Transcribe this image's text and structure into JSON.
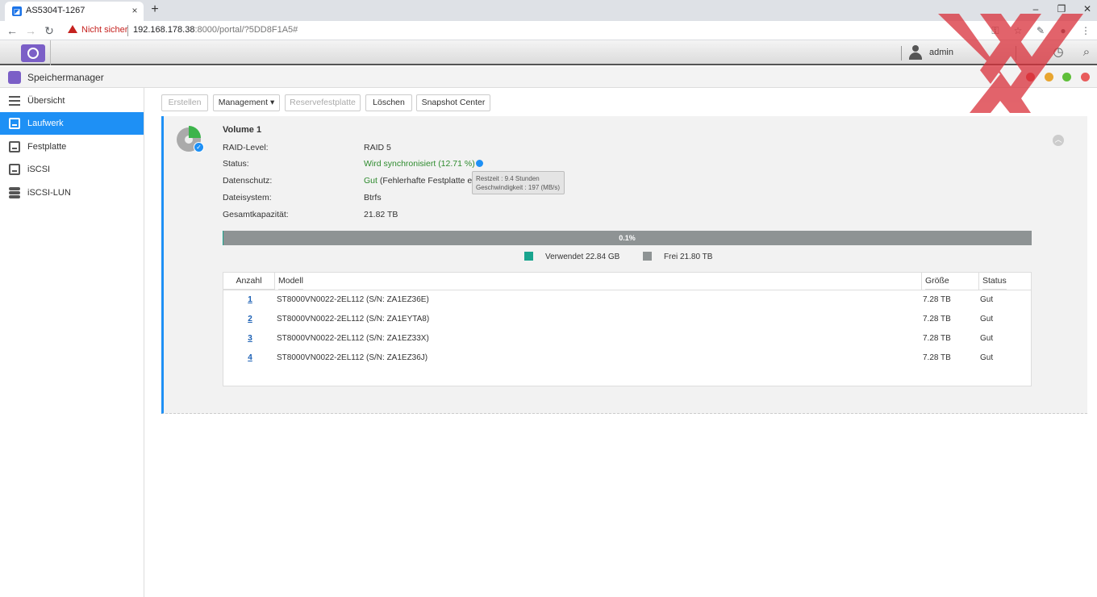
{
  "browser": {
    "tab_title": "AS5304T-1267",
    "tab_close": "×",
    "new_tab": "+",
    "window_controls": {
      "minimize": "–",
      "restore": "❐",
      "close": "✕"
    },
    "nav": {
      "back": "←",
      "forward": "→",
      "reload": "↻"
    },
    "security_label": "Nicht sicher",
    "url_host": "192.168.178.38",
    "url_rest": ":8000/portal/?5DD8F1A5#",
    "icons": {
      "key": "⚿",
      "star": "☆",
      "ext": "✎",
      "menu": "⋮"
    }
  },
  "adm": {
    "username": "admin",
    "icons": {
      "notify": "◷",
      "search": "⌕"
    }
  },
  "app": {
    "title": "Speichermanager",
    "window_dots": [
      "#e04a4a",
      "#e8a530",
      "#5fbf3a",
      "#e85b5b"
    ]
  },
  "sidebar": {
    "items": [
      {
        "label": "Übersicht",
        "active": false
      },
      {
        "label": "Laufwerk",
        "active": true
      },
      {
        "label": "Festplatte",
        "active": false
      },
      {
        "label": "iSCSI",
        "active": false
      },
      {
        "label": "iSCSI-LUN",
        "active": false
      }
    ]
  },
  "toolbar": {
    "create": "Erstellen",
    "management": "Management ▾",
    "spare": "Reservefestplatte",
    "delete": "Löschen",
    "snapshot": "Snapshot Center"
  },
  "volume": {
    "title": "Volume 1",
    "raid_label": "RAID-Level:",
    "raid_value": "RAID 5",
    "status_label": "Status:",
    "status_value": "Wird synchronisiert (12.71 %)",
    "protection_label": "Datenschutz:",
    "protection_good": "Gut",
    "protection_detail": " (Fehlerhafte Festplatte erlaub",
    "fs_label": "Dateisystem:",
    "fs_value": "Btrfs",
    "capacity_label": "Gesamtkapazität:",
    "capacity_value": "21.82 TB",
    "collapse": "︿"
  },
  "tooltip": {
    "line1": "Restzeit : 9.4 Stunden",
    "line2": "Geschwindigkeit : 197 (MB/s)"
  },
  "usage": {
    "percent_text": "0.1%",
    "used_fraction": 0.001,
    "used_label": "Verwendet 22.84 GB",
    "free_label": "Frei 21.80 TB",
    "used_color": "#1aa58f",
    "free_color": "#8e9394"
  },
  "disks": {
    "headers": {
      "count": "Anzahl",
      "model": "Modell",
      "size": "Größe",
      "status": "Status"
    },
    "rows": [
      {
        "num": "1",
        "model": "ST8000VN0022-2EL112 (S/N: ZA1EZ36E)",
        "size": "7.28 TB",
        "status": "Gut"
      },
      {
        "num": "2",
        "model": "ST8000VN0022-2EL112 (S/N: ZA1EYTA8)",
        "size": "7.28 TB",
        "status": "Gut"
      },
      {
        "num": "3",
        "model": "ST8000VN0022-2EL112 (S/N: ZA1EZ33X)",
        "size": "7.28 TB",
        "status": "Gut"
      },
      {
        "num": "4",
        "model": "ST8000VN0022-2EL112 (S/N: ZA1EZ36J)",
        "size": "7.28 TB",
        "status": "Gut"
      }
    ]
  }
}
